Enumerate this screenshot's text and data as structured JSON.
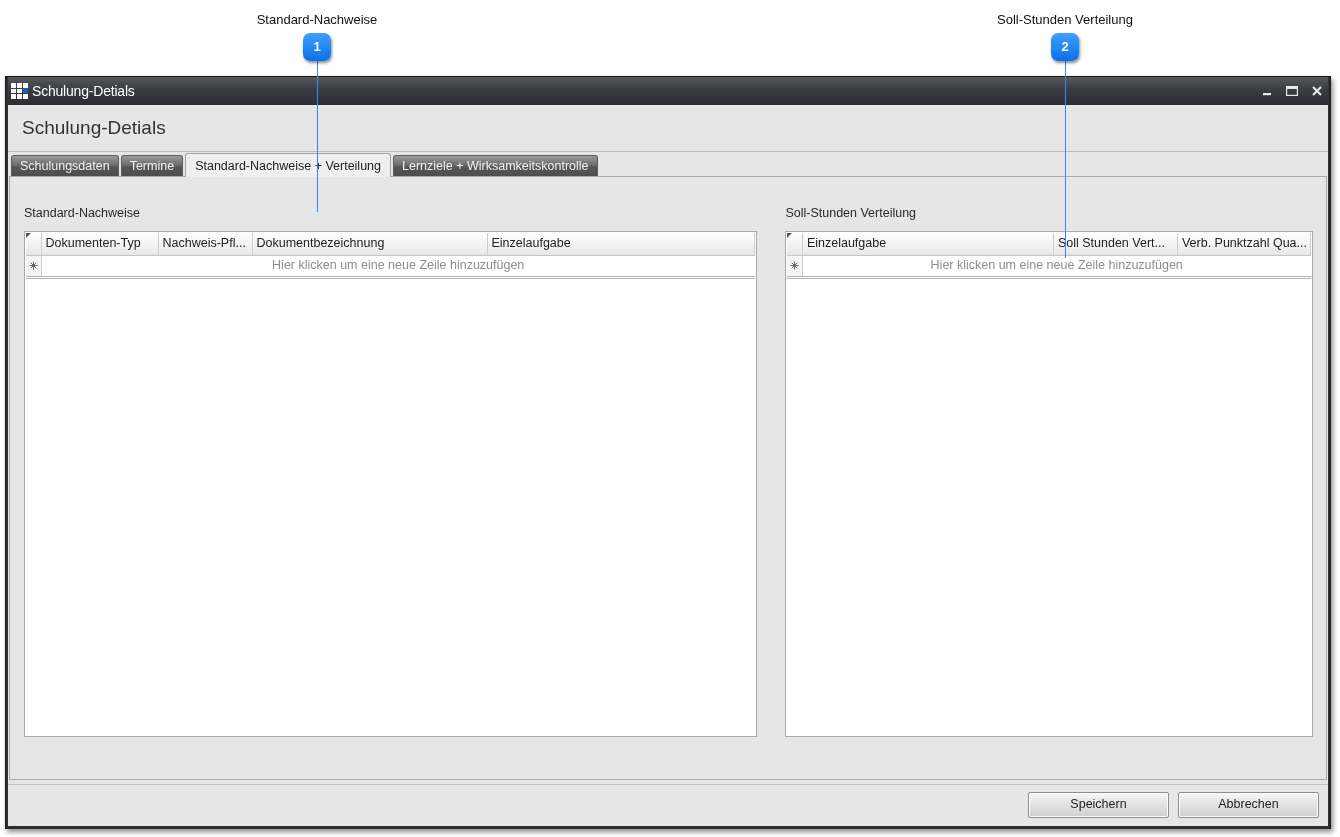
{
  "annotations": [
    {
      "number": "1",
      "label": "Standard-Nachweise"
    },
    {
      "number": "2",
      "label": "Soll-Stunden Verteilung"
    }
  ],
  "window": {
    "title": "Schulung-Detials"
  },
  "heading": "Schulung-Detials",
  "tabs": [
    {
      "label": "Schulungsdaten",
      "selected": false
    },
    {
      "label": "Termine",
      "selected": false
    },
    {
      "label": "Standard-Nachweise + Verteilung",
      "selected": true
    },
    {
      "label": "Lernziele + Wirksamkeitskontrolle",
      "selected": false
    }
  ],
  "grids": [
    {
      "title": "Standard-Nachweise",
      "columns": [
        "Dokumenten-Typ",
        "Nachweis-Pfl...",
        "Dokumentbezeichnung",
        "Einzelaufgabe"
      ],
      "new_row_hint": "Hier klicken um eine neue Zeile hinzuzufügen"
    },
    {
      "title": "Soll-Stunden Verteilung",
      "columns": [
        "Einzelaufgabe",
        "Soll Stunden Vert...",
        "Verb. Punktzahl Qua..."
      ],
      "new_row_hint": "Hier klicken um eine neue Zeile hinzuzufügen"
    }
  ],
  "buttons": [
    "Speichern",
    "Abbrechen"
  ]
}
